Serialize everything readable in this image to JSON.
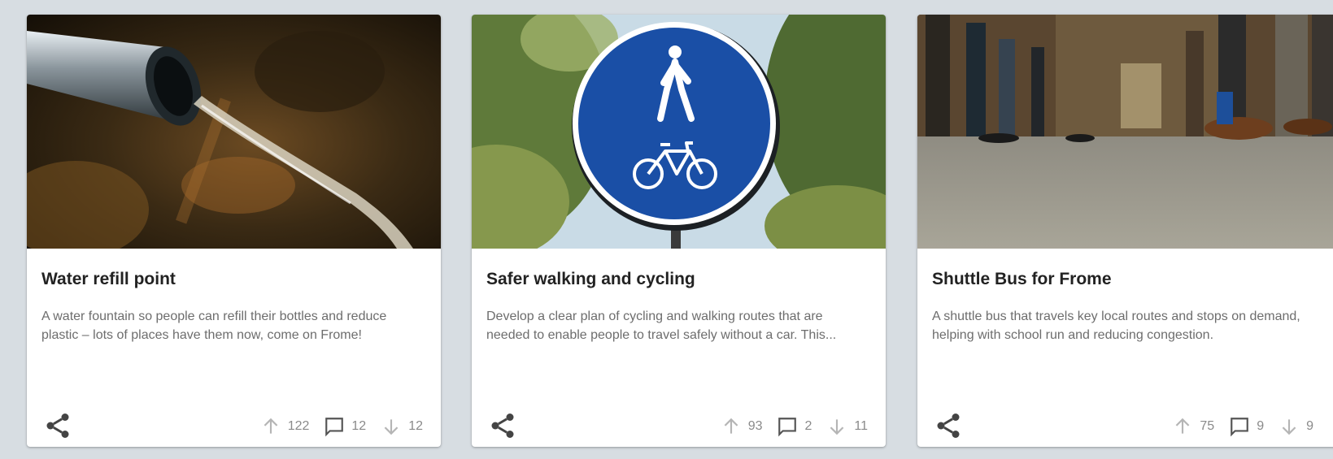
{
  "cards": [
    {
      "title": "Water refill point",
      "description": "A water fountain so people can refill their bottles and reduce plastic – lots of places have them now, come on Frome!",
      "image": "water-fountain-photo",
      "upvotes": "122",
      "comments": "12",
      "downvotes": "12"
    },
    {
      "title": "Safer walking and cycling",
      "description": "Develop a clear plan of cycling and walking routes that are needed to enable people to travel safely without a car. This...",
      "image": "pedestrian-cycle-sign-photo",
      "upvotes": "93",
      "comments": "2",
      "downvotes": "11"
    },
    {
      "title": "Shuttle Bus for Frome",
      "description": "A shuttle bus that travels key local routes and stops on demand, helping with school run and reducing congestion.",
      "image": "bus-interior-photo",
      "upvotes": "75",
      "comments": "9",
      "downvotes": "9"
    }
  ],
  "icons": {
    "share": "share-icon",
    "upvote": "arrow-up-icon",
    "comment": "comment-icon",
    "downvote": "arrow-down-icon"
  },
  "colors": {
    "background": "#d7dde2",
    "card": "#ffffff",
    "title": "#222222",
    "description": "#6d6d6d",
    "icon_muted": "#b5b5b5",
    "icon_dark": "#444444",
    "sign_blue": "#1a4fa6"
  }
}
